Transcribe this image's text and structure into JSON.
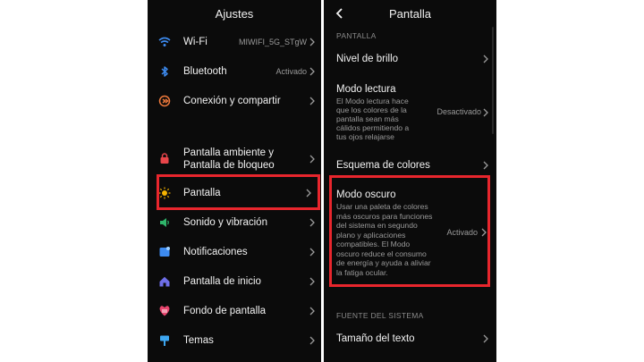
{
  "left_screen": {
    "title": "Ajustes",
    "items": [
      {
        "label": "Wi-Fi",
        "value": "MIWIFI_5G_STgW",
        "icon": "wifi-icon"
      },
      {
        "label": "Bluetooth",
        "value": "Activado",
        "icon": "bluetooth-icon"
      },
      {
        "label": "Conexión y compartir",
        "value": "",
        "icon": "connection-share-icon"
      },
      {
        "label_line1": "Pantalla ambiente y",
        "label_line2": "Pantalla de bloqueo",
        "icon": "lock-icon"
      },
      {
        "label": "Pantalla",
        "icon": "brightness-icon"
      },
      {
        "label": "Sonido y vibración",
        "icon": "speaker-icon"
      },
      {
        "label": "Notificaciones",
        "icon": "notification-icon"
      },
      {
        "label": "Pantalla de inicio",
        "icon": "home-icon"
      },
      {
        "label": "Fondo de pantalla",
        "icon": "wallpaper-icon"
      },
      {
        "label": "Temas",
        "icon": "brush-icon"
      }
    ]
  },
  "right_screen": {
    "title": "Pantalla",
    "section_display": "PANTALLA",
    "brightness": {
      "label": "Nivel de brillo"
    },
    "reading_mode": {
      "label": "Modo lectura",
      "desc_lines": [
        "El Modo lectura hace",
        "que los colores de la",
        "pantalla sean más",
        "cálidos permitiendo a",
        "tus ojos relajarse"
      ],
      "value": "Desactivado"
    },
    "color_scheme": {
      "label": "Esquema de colores"
    },
    "dark_mode": {
      "label": "Modo oscuro",
      "desc_lines": [
        "Usar una paleta de colores",
        "más oscuros para funciones",
        "del sistema en segundo",
        "plano y aplicaciones",
        "compatibles. El Modo",
        "oscuro reduce el consumo",
        "de energía y ayuda a aliviar",
        "la fatiga ocular."
      ],
      "value": "Activado"
    },
    "section_font": "FUENTE DEL SISTEMA",
    "text_size": {
      "label": "Tamaño del texto"
    }
  },
  "colors": {
    "background": "#0b0b0b",
    "highlight": "#e8262d",
    "wifi": "#3d8bf0",
    "bluetooth": "#3d8bf0",
    "connection": "#f07a3c",
    "lock": "#e8454a",
    "brightness": "#f5b400",
    "sound": "#2fb56a",
    "notifications": "#3d8bf0",
    "home": "#6e6ee8",
    "wallpaper": "#e8456e",
    "themes": "#3da6f0"
  }
}
